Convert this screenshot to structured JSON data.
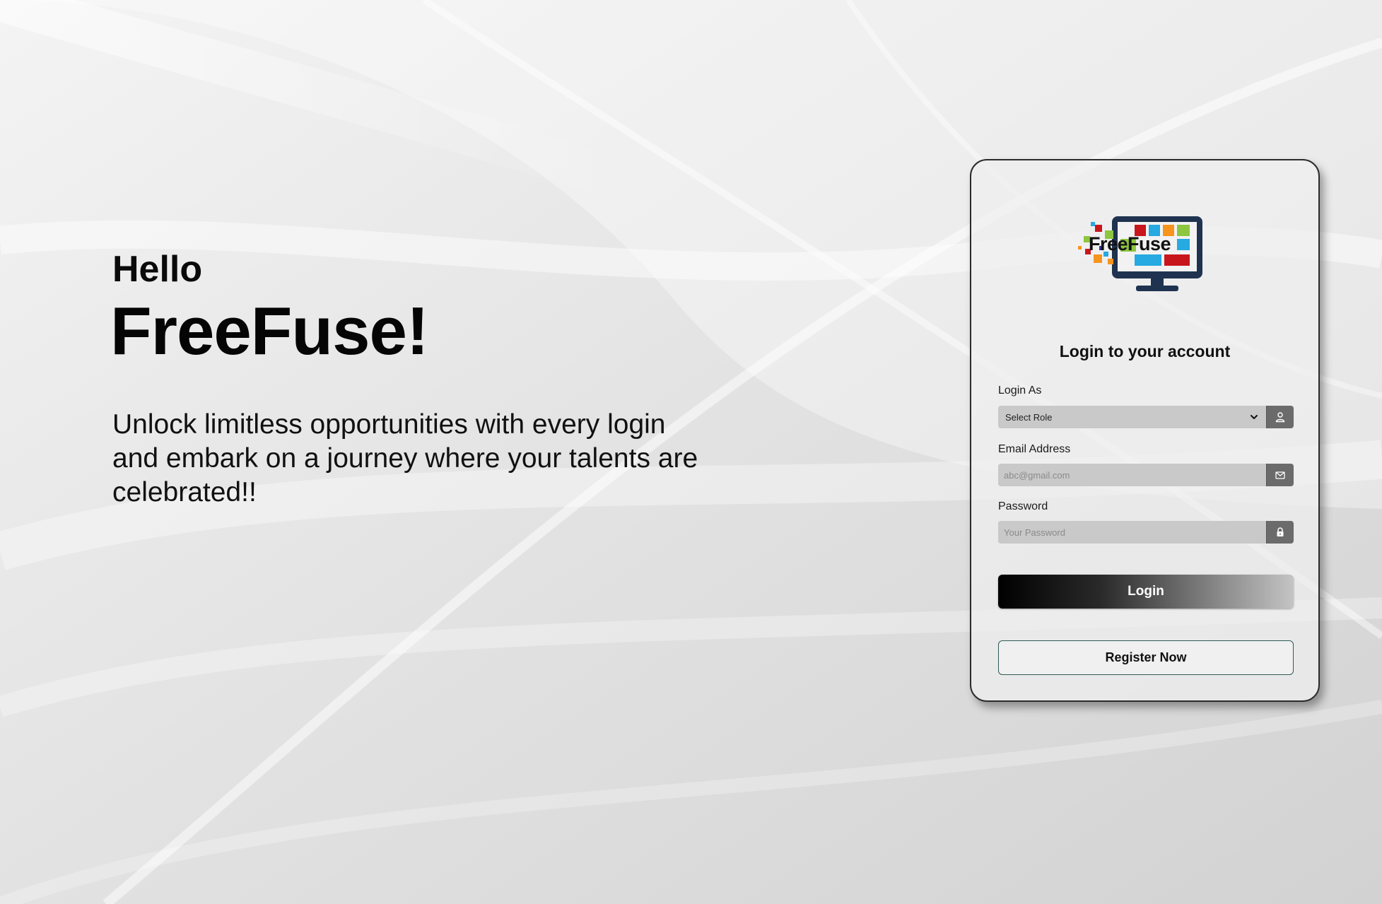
{
  "hero": {
    "greeting": "Hello",
    "brand": "FreeFuse!",
    "tagline": "Unlock limitless opportunities with every login and embark on a journey where your talents are celebrated!!"
  },
  "login_card": {
    "logo_text": "FreeFuse",
    "title": "Login to your account",
    "role": {
      "label": "Login As",
      "selected": "Select Role",
      "icon": "user-icon"
    },
    "email": {
      "label": "Email Address",
      "placeholder": "abc@gmail.com",
      "icon": "mail-icon"
    },
    "password": {
      "label": "Password",
      "placeholder": "Your Password",
      "icon": "lock-icon"
    },
    "login_button": "Login",
    "register_button": "Register Now"
  },
  "colors": {
    "background": "#d9d9d9",
    "input_bg": "#c9c9c9",
    "addon_bg": "#6b6b6b",
    "register_border": "#2f5a55"
  }
}
